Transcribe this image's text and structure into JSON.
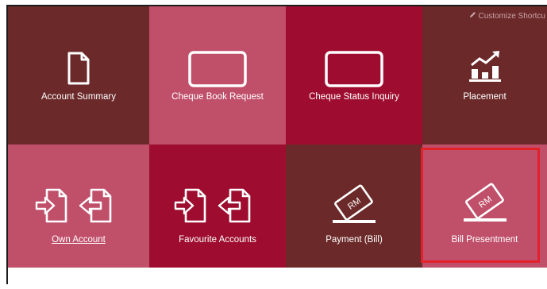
{
  "customize": {
    "label": "Customize Shortcu",
    "icon": "pencil-icon"
  },
  "colors": {
    "dark_maroon": "#6b2929",
    "rose": "#c04f6a",
    "crimson": "#9e0d2f",
    "highlight": "#e3212b"
  },
  "tiles": [
    {
      "label": "Account Summary",
      "icon": "document-icon"
    },
    {
      "label": "Cheque Book Request",
      "icon": "cheque-icon"
    },
    {
      "label": "Cheque Status Inquiry",
      "icon": "cheque-icon"
    },
    {
      "label": "Placement",
      "icon": "bar-chart-growth-icon"
    },
    {
      "label": "Own Account",
      "icon": "transfer-documents-icon"
    },
    {
      "label": "Favourite Accounts",
      "icon": "transfer-documents-icon"
    },
    {
      "label": "Payment (Bill)",
      "icon": "bill-rm-icon",
      "icon_text": "RM"
    },
    {
      "label": "Bill Presentment",
      "icon": "bill-rm-icon",
      "icon_text": "RM"
    }
  ]
}
